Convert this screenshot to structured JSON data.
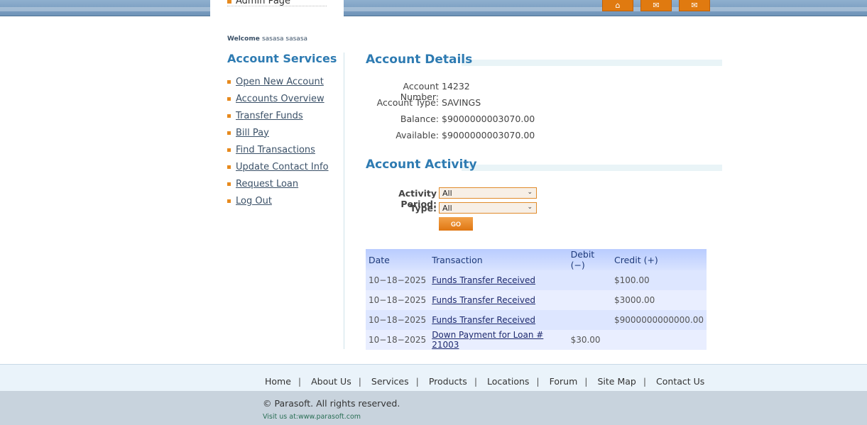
{
  "header": {
    "admin_link": "Admin Page"
  },
  "sidebar": {
    "welcome_label": "Welcome",
    "welcome_name": "sasasa sasasa",
    "title": "Account Services",
    "items": [
      {
        "label": "Open New Account"
      },
      {
        "label": "Accounts Overview"
      },
      {
        "label": "Transfer Funds"
      },
      {
        "label": "Bill Pay"
      },
      {
        "label": "Find Transactions"
      },
      {
        "label": "Update Contact Info"
      },
      {
        "label": "Request Loan"
      },
      {
        "label": "Log Out"
      }
    ]
  },
  "details": {
    "title": "Account Details",
    "account_number_label": "Account Number:",
    "account_number": "14232",
    "account_type_label": "Account Type:",
    "account_type": "SAVINGS",
    "balance_label": "Balance:",
    "balance": "$9000000003070.00",
    "available_label": "Available:",
    "available": "$9000000003070.00"
  },
  "activity": {
    "title": "Account Activity",
    "period_label": "Activity Period:",
    "period_value": "All",
    "type_label": "Type:",
    "type_value": "All",
    "go_label": "GO",
    "columns": [
      "Date",
      "Transaction",
      "Debit (−)",
      "Credit (+)"
    ],
    "rows": [
      {
        "date": "10−18−2025",
        "transaction": "Funds Transfer Received",
        "debit": "",
        "credit": "$100.00"
      },
      {
        "date": "10−18−2025",
        "transaction": "Funds Transfer Received",
        "debit": "",
        "credit": "$3000.00"
      },
      {
        "date": "10−18−2025",
        "transaction": "Funds Transfer Received",
        "debit": "",
        "credit": "$9000000000000.00"
      },
      {
        "date": "10−18−2025",
        "transaction": "Down Payment for Loan # 21003",
        "debit": "$30.00",
        "credit": ""
      }
    ]
  },
  "footer": {
    "links": [
      "Home",
      "About Us",
      "Services",
      "Products",
      "Locations",
      "Forum",
      "Site Map",
      "Contact Us"
    ],
    "copyright": "© Parasoft. All rights reserved.",
    "visit": "Visit us at:www.parasoft.com"
  },
  "colors": {
    "accent": "#2e7bb2",
    "orange": "#e07a10"
  }
}
